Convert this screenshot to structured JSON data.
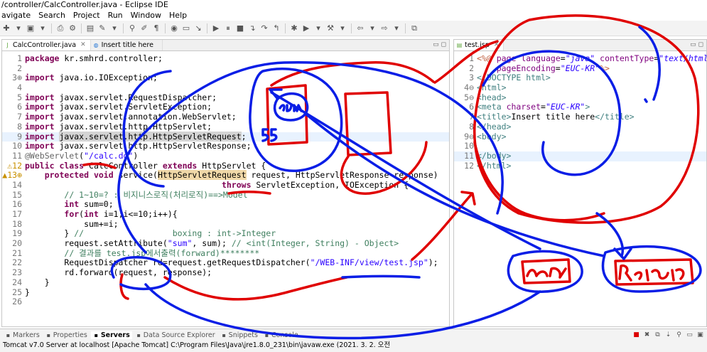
{
  "window": {
    "title": "/controller/CalcController.java - Eclipse IDE"
  },
  "menu": [
    "avigate",
    "Search",
    "Project",
    "Run",
    "Window",
    "Help"
  ],
  "left_editor": {
    "tabs": [
      {
        "label": "CalcController.java",
        "icon": "java-file-icon",
        "active": true
      },
      {
        "label": "Insert title here",
        "icon": "browser-icon",
        "active": false
      }
    ],
    "lines": [
      {
        "n": "1",
        "html": "<span class='kw'>package</span> kr.smhrd.controller;"
      },
      {
        "n": "2",
        "html": ""
      },
      {
        "n": "3⊕",
        "html": "<span class='kw'>import</span> java.io.IOException;"
      },
      {
        "n": "4",
        "html": ""
      },
      {
        "n": "5",
        "html": "<span class='kw'>import</span> javax.servlet.RequestDispatcher;"
      },
      {
        "n": "6",
        "html": "<span class='kw'>import</span> javax.servlet.ServletException;"
      },
      {
        "n": "7",
        "html": "<span class='kw'>import</span> javax.servlet.annotation.WebServlet;"
      },
      {
        "n": "8",
        "html": "<span class='kw'>import</span> javax.servlet.http.HttpServlet;"
      },
      {
        "n": "9",
        "html": "<span class='kw'>import</span> <span class='sel'>javax.servlet.http.HttpServletRequest</span>;",
        "hl": true
      },
      {
        "n": "10",
        "html": "<span class='kw'>import</span> javax.servlet.http.HttpServletResponse;"
      },
      {
        "n": "11",
        "html": "<span class='ann'>@WebServlet</span>(<span class='str'>\"/calc.do\"</span>)"
      },
      {
        "n": "12",
        "html": "<span class='kw'>public class</span> CalcController <span class='kw'>extends</span> HttpServlet {",
        "mk": "⚠"
      },
      {
        "n": "13⊕",
        "html": "    <span class='kw'>protected void</span> service(<span class='occ'>HttpServletRequest</span> request, HttpServletResponse response)",
        "mk": "▲"
      },
      {
        "n": "14",
        "html": "                                        <span class='kw'>throws</span> ServletException, IOException {"
      },
      {
        "n": "15",
        "html": "        <span class='cm'>// 1~10=? : 비지니스로직(처리로직)==>Model</span>"
      },
      {
        "n": "16",
        "html": "        <span class='kw'>int</span> sum=0;"
      },
      {
        "n": "17",
        "html": "        <span class='kw'>for</span>(<span class='kw'>int</span> i=1;i&lt;=10;i++){"
      },
      {
        "n": "18",
        "html": "            sum+=i;"
      },
      {
        "n": "19",
        "html": "        } <span class='cm'>//                  boxing : int-&gt;Integer</span>"
      },
      {
        "n": "20",
        "html": "        request.setAttribute(<span class='str'>\"sum\"</span>, sum); <span class='cm'>// &lt;int(Integer, String) - Object&gt;</span>"
      },
      {
        "n": "21",
        "html": "        <span class='cm'>// 결과를 test.jsp에서출력(forward)********</span>"
      },
      {
        "n": "22",
        "html": "        RequestDispatcher rd=request.getRequestDispatcher(<span class='str'>\"/WEB-INF/view/test.jsp\"</span>);"
      },
      {
        "n": "23",
        "html": "        rd.forward(request, response);"
      },
      {
        "n": "24",
        "html": "    }"
      },
      {
        "n": "25",
        "html": "}"
      },
      {
        "n": "26",
        "html": ""
      }
    ]
  },
  "right_editor": {
    "tabs": [
      {
        "label": "test.jsp",
        "icon": "jsp-file-icon",
        "active": true
      }
    ],
    "lines": [
      {
        "n": "1",
        "html": "<span class='pi'>&lt;%@</span> <span class='att'>page</span> <span class='att'>language</span>=<span class='val'>\"java\"</span> <span class='att'>contentType</span>=<span class='val'>\"text/html</span>"
      },
      {
        "n": "2",
        "html": "    <span class='att'>pageEncoding</span>=<span class='val'>\"EUC-KR\"</span><span class='pi'>%&gt;</span>"
      },
      {
        "n": "3",
        "html": "<span class='tag'>&lt;!DOCTYPE html&gt;</span>"
      },
      {
        "n": "4⊖",
        "html": "<span class='tag'>&lt;html&gt;</span>"
      },
      {
        "n": "5⊖",
        "html": "<span class='tag'>&lt;head&gt;</span>"
      },
      {
        "n": "6",
        "html": "<span class='tag'>&lt;meta</span> <span class='att'>charset</span>=<span class='val'>\"EUC-KR\"</span><span class='tag'>&gt;</span>"
      },
      {
        "n": "7",
        "html": "<span class='tag'>&lt;title&gt;</span>Insert title here<span class='tag'>&lt;/title&gt;</span>"
      },
      {
        "n": "8",
        "html": "<span class='tag'>&lt;/head&gt;</span>"
      },
      {
        "n": "9⊖",
        "html": "<span class='tag'>&lt;body&gt;</span>"
      },
      {
        "n": "10",
        "html": ""
      },
      {
        "n": "11",
        "html": "<span class='tag'>&lt;/body&gt;</span>",
        "hl": true
      },
      {
        "n": "12",
        "html": "<span class='tag'>&lt;/html&gt;</span>"
      }
    ]
  },
  "bottom": {
    "tabs": [
      {
        "label": "Markers",
        "active": false
      },
      {
        "label": "Properties",
        "active": false
      },
      {
        "label": "Servers",
        "active": true
      },
      {
        "label": "Data Source Explorer",
        "active": false
      },
      {
        "label": "Snippets",
        "active": false
      },
      {
        "label": "Console",
        "active": false
      }
    ],
    "console_text": "Tomcat v7.0 Server at localhost [Apache Tomcat] C:\\Program Files\\Java\\jre1.8.0_231\\bin\\javaw.exe  (2021. 3. 2. 오전"
  },
  "handwriting": {
    "labels": [
      "sum",
      "55",
      "request",
      "response"
    ]
  },
  "colors": {
    "pen_red": "#e00000",
    "pen_blue": "#0a1ee6"
  }
}
